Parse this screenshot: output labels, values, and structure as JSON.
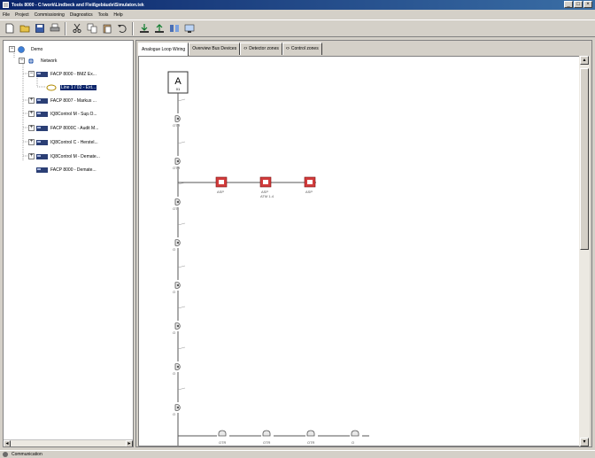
{
  "window": {
    "title": "Tools 8000 - C:\\work\\Lindbeck and Fleißgebäude\\Simulaton.tek",
    "min": "_",
    "restore": "□",
    "close": "×"
  },
  "menu": [
    "File",
    "Project",
    "Commissioning",
    "Diagnostics",
    "Tools",
    "Help"
  ],
  "toolbar": [
    "new-file-icon",
    "open-folder-icon",
    "save-icon",
    "print-icon",
    "cut-icon",
    "copy-icon",
    "paste-icon",
    "undo-icon",
    "download-icon",
    "upload-icon",
    "compare-icon",
    "monitor-icon"
  ],
  "tree": {
    "root": "Demo",
    "network": "Network",
    "panels": [
      {
        "label": "FACP 8000 - BMZ Ex...",
        "expanded": true
      },
      {
        "label": "FACP 8007 - Markus ...",
        "expanded": false
      },
      {
        "label": "IQ8Control M - Sup.O...",
        "expanded": false
      },
      {
        "label": "FACP 8000C - Audit M...",
        "expanded": false
      },
      {
        "label": "IQ8Control C - Herstel...",
        "expanded": false
      },
      {
        "label": "IQ8Control M - Demate...",
        "expanded": false
      },
      {
        "label": "FACP 8000 - Demate...",
        "expanded": false
      }
    ],
    "selected_loop": "Line 1 / 02 - Ext..."
  },
  "tabs": [
    {
      "label": "Analogue Loop Wiring",
      "active": true
    },
    {
      "label": "Overview Bus Devices",
      "active": false
    },
    {
      "label": "Detector zones",
      "active": false
    },
    {
      "label": "Control zones",
      "active": false
    }
  ],
  "diagram": {
    "loop_letter": "A",
    "loop_sub": "01",
    "detector_labels": [
      "OTR",
      "OTR",
      "OT",
      "O",
      "O",
      "O",
      "O",
      "O"
    ],
    "sounder_labels": [
      "ASP",
      "ASP",
      "ASP"
    ],
    "sounder_note": "ATM 1-4",
    "bottom_labels": [
      "OTR",
      "OTR",
      "OTR",
      "O"
    ]
  },
  "status": {
    "text": "Communication"
  },
  "colors": {
    "titlebar": "#0a246a",
    "sounder": "#d23c3c",
    "selection": "#0a246a"
  }
}
